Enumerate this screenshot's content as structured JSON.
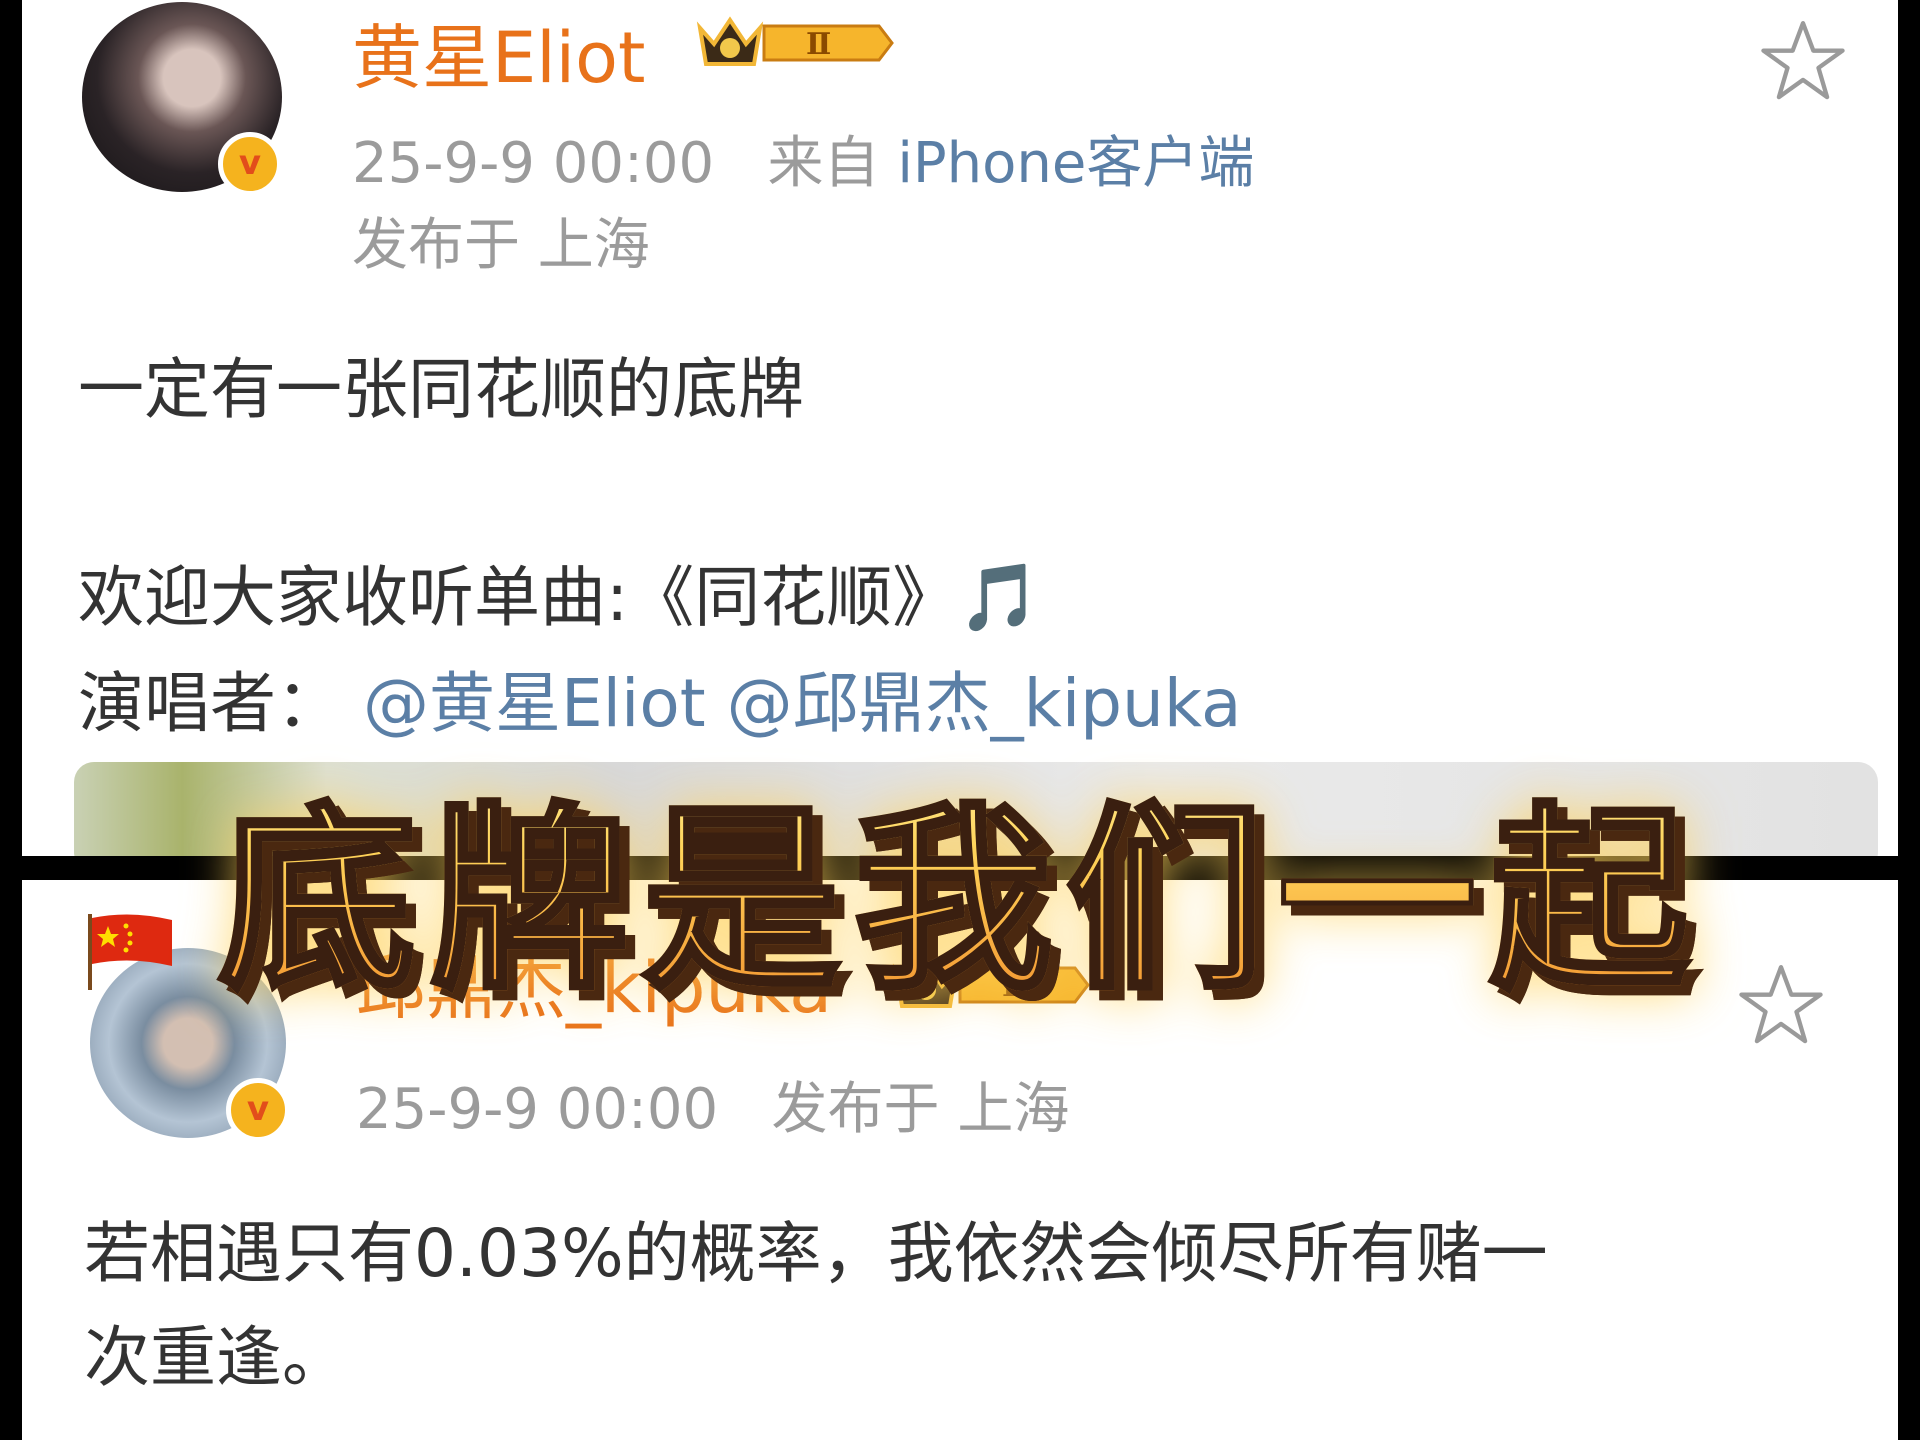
{
  "post1": {
    "username": "黄星Eliot",
    "vip_level": "Ⅱ",
    "date": "25-9-9 00:00",
    "source_prefix": "来自",
    "source": "iPhone客户端",
    "location": "发布于 上海",
    "content_line1": "一定有一张同花顺的底牌",
    "content_line2": "欢迎大家收听单曲:《同花顺》🎵",
    "content_line3_prefix": "演唱者：",
    "mention1": "@黄星Eliot",
    "mention2": "@邱鼎杰_kipuka"
  },
  "post2": {
    "username": "邱鼎杰_kipuka",
    "vip_level": "Ⅱ",
    "date": "25-9-9 00:00",
    "location": "发布于 上海",
    "content_line1": "若相遇只有0.03%的概率，我依然会倾尽所有赌一",
    "content_line2": "次重逢。"
  },
  "overlay_caption": "底牌是我们一起",
  "colors": {
    "username": "#e8721a",
    "link": "#5b7fa6",
    "meta": "#9b9b9b",
    "body_text": "#333333",
    "verify_badge": "#f5b31e"
  }
}
